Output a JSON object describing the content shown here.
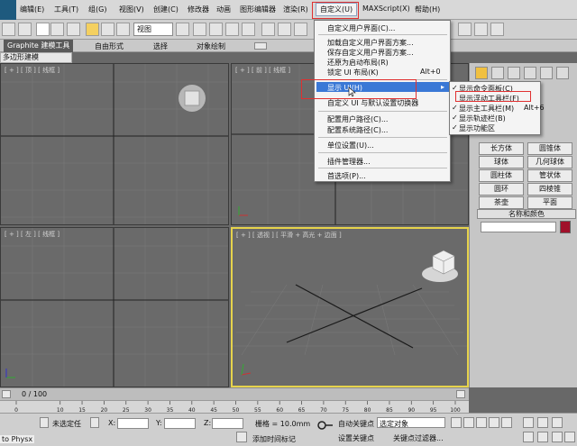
{
  "menubar": {
    "items": [
      "编辑(E)",
      "工具(T)",
      "组(G)",
      "视图(V)",
      "创建(C)",
      "修改器",
      "动画",
      "图形编辑器",
      "渲染(R)",
      "自定义(U)",
      "MAXScript(X)",
      "帮助(H)"
    ]
  },
  "toolbar": {
    "view_select": "视图"
  },
  "ribbon": {
    "tabs": [
      "Graphite 建模工具",
      "自由形式",
      "选择",
      "对象绘制"
    ],
    "subtab": "多边形建模"
  },
  "viewports": {
    "top_left_label": "[ + ] [ 顶 ] [ 线框 ]",
    "top_right_label": "[ + ] [ 前 ] [ 线框 ]",
    "bottom_left_label": "[ + ] [ 左 ] [ 线框 ]",
    "bottom_right_label": "[ + ] [ 透视 ] [ 平滑 + 高光 + 边面 ]"
  },
  "custom_menu": {
    "items": [
      {
        "label": "自定义用户界面(C)...",
        "shortcut": ""
      },
      {
        "label": "加载自定义用户界面方案...",
        "shortcut": ""
      },
      {
        "label": "保存自定义用户界面方案...",
        "shortcut": ""
      },
      {
        "label": "还原为启动布局(R)",
        "shortcut": ""
      },
      {
        "label": "锁定 UI 布局(K)",
        "shortcut": "Alt+0"
      },
      {
        "label": "显示 UI(H)",
        "shortcut": ""
      },
      {
        "label": "自定义 UI 与默认设置切换器",
        "shortcut": ""
      },
      {
        "label": "配置用户路径(C)...",
        "shortcut": ""
      },
      {
        "label": "配置系统路径(C)...",
        "shortcut": ""
      },
      {
        "label": "单位设置(U)...",
        "shortcut": ""
      },
      {
        "label": "插件管理器...",
        "shortcut": ""
      },
      {
        "label": "首选项(P)...",
        "shortcut": ""
      }
    ]
  },
  "show_ui_submenu": {
    "items": [
      {
        "label": "显示命令面板(C)",
        "checked": true,
        "shortcut": ""
      },
      {
        "label": "显示浮动工具栏(F)",
        "checked": false,
        "shortcut": ""
      },
      {
        "label": "显示主工具栏(M)",
        "checked": true,
        "shortcut": "Alt+6"
      },
      {
        "label": "显示轨迹栏(B)",
        "checked": true,
        "shortcut": ""
      },
      {
        "label": "显示功能区",
        "checked": true,
        "shortcut": ""
      }
    ]
  },
  "command_panel": {
    "primitives": [
      "长方体",
      "圆锥体",
      "球体",
      "几何球体",
      "圆柱体",
      "管状体",
      "圆环",
      "四棱锥",
      "茶壶",
      "平面"
    ],
    "name_color_label": "名称和颜色",
    "color": "#a0102a"
  },
  "timeline": {
    "frame": "0 / 100",
    "ticks": [
      "0",
      "10",
      "15",
      "20",
      "25",
      "30",
      "35",
      "40",
      "45",
      "50",
      "55",
      "60",
      "65",
      "70",
      "75",
      "80",
      "85",
      "90",
      "95",
      "100"
    ]
  },
  "status": {
    "selection": "未选定任",
    "x_label": "X:",
    "y_label": "Y:",
    "z_label": "Z:",
    "grid": "栅格 = 10.0mm",
    "auto_key": "自动关键点",
    "set_key": "设置关键点",
    "selected_object": "选定对象",
    "key_filter": "关键点过滤器...",
    "add_time_tag": "添加时间标记",
    "physx": "to Physx"
  },
  "colors": {
    "highlight": "#3a78d6",
    "callout": "#e03030",
    "active_viewport": "#e6d34c"
  }
}
